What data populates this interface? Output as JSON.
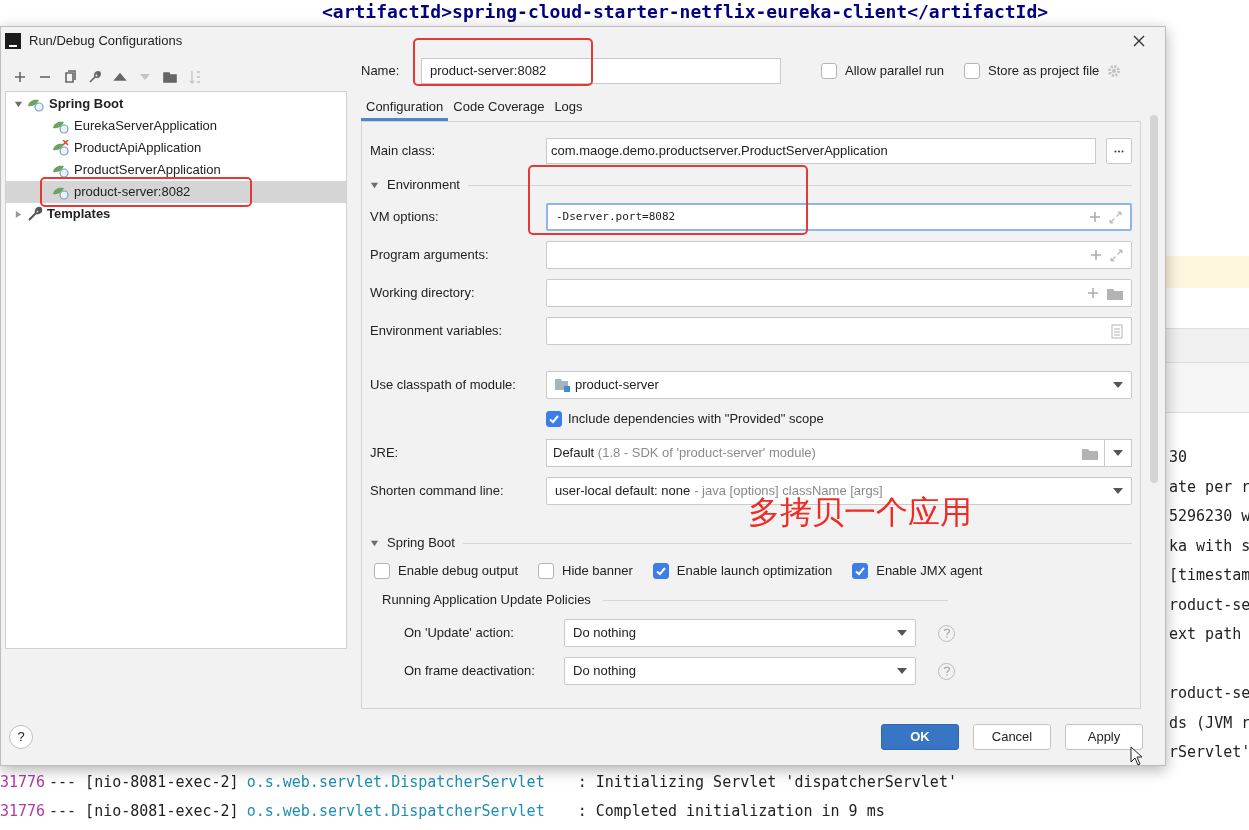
{
  "editor": {
    "code_line": "<artifactId>spring-cloud-starter-netflix-eureka-client</artifactId>"
  },
  "console": {
    "line_groups": [
      [
        "30",
        "ate per r",
        "5296230 w",
        "ka with s",
        "[timestam",
        "roduct-se",
        "ext path"
      ],
      [
        "roduct-se",
        "ds (JVM r",
        "rServlet'"
      ]
    ],
    "log_lines": [
      {
        "pid": "31776",
        "thread": "--- [nio-8081-exec-2]",
        "logger": "o.s.web.servlet.DispatcherServlet",
        "message": ": Initializing Servlet 'dispatcherServlet'"
      },
      {
        "pid": "31776",
        "thread": "--- [nio-8081-exec-2]",
        "logger": "o.s.web.servlet.DispatcherServlet",
        "message": ": Completed initialization in 9 ms"
      }
    ]
  },
  "dialog": {
    "title": "Run/Debug Configurations",
    "tree": [
      {
        "label": "Spring Boot",
        "expanded": true,
        "children": [
          {
            "label": "EurekaServerApplication",
            "error": false,
            "selected": false,
            "highlighted": false
          },
          {
            "label": "ProductApiApplication",
            "error": true,
            "selected": false,
            "highlighted": false
          },
          {
            "label": "ProductServerApplication",
            "error": false,
            "selected": false,
            "highlighted": false
          },
          {
            "label": "product-server:8082",
            "error": false,
            "selected": true,
            "highlighted": true
          }
        ]
      },
      {
        "label": "Templates",
        "expanded": false
      }
    ],
    "name": {
      "label": "Name:",
      "value": "product-server:8082",
      "highlighted": true
    },
    "options": [
      {
        "label": "Allow parallel run",
        "checked": false
      },
      {
        "label": "Store as project file",
        "checked": false
      }
    ],
    "tabs": [
      {
        "label": "Configuration",
        "selected": true
      },
      {
        "label": "Code Coverage",
        "selected": false
      },
      {
        "label": "Logs",
        "selected": false
      }
    ],
    "main_class": {
      "label": "Main class:",
      "value": "com.maoge.demo.productserver.ProductServerApplication"
    },
    "environment": {
      "title": "Environment",
      "expanded": true,
      "fields": [
        {
          "label": "VM options:",
          "kind": "expandable",
          "value": "-Dserver.port=8082",
          "focused": true,
          "highlighted": true
        },
        {
          "label": "Program arguments:",
          "kind": "expandable",
          "focused": false,
          "highlighted": false
        },
        {
          "label": "Working directory:",
          "kind": "folder",
          "focused": false,
          "highlighted": false
        },
        {
          "label": "Environment variables:",
          "kind": "document",
          "focused": false,
          "highlighted": false
        }
      ]
    },
    "classpath": {
      "label": "Use classpath of module:",
      "value": "product-server"
    },
    "include_provided": {
      "label": "Include dependencies with \"Provided\" scope",
      "checked": true
    },
    "jre": {
      "label": "JRE:",
      "value": "Default",
      "hint": "(1.8 - SDK of 'product-server' module)"
    },
    "shorten": {
      "label": "Shorten command line:",
      "value": "user-local default: none",
      "hint": "- java [options] className [args]"
    },
    "annotation": "多拷贝一个应用",
    "spring_boot": {
      "title": "Spring Boot",
      "expanded": true,
      "checkboxes": [
        {
          "label": "Enable debug output",
          "checked": false
        },
        {
          "label": "Hide banner",
          "checked": false
        },
        {
          "label": "Enable launch optimization",
          "checked": true
        },
        {
          "label": "Enable JMX agent",
          "checked": true
        }
      ],
      "policies_title": "Running Application Update Policies",
      "policies": [
        {
          "label": "On 'Update' action:",
          "value": "Do nothing"
        },
        {
          "label": "On frame deactivation:",
          "value": "Do nothing"
        }
      ]
    },
    "help": "?",
    "buttons": [
      {
        "label": "OK",
        "kind": "primary"
      },
      {
        "label": "Cancel",
        "kind": "normal"
      },
      {
        "label": "Apply",
        "kind": "normal"
      }
    ]
  }
}
